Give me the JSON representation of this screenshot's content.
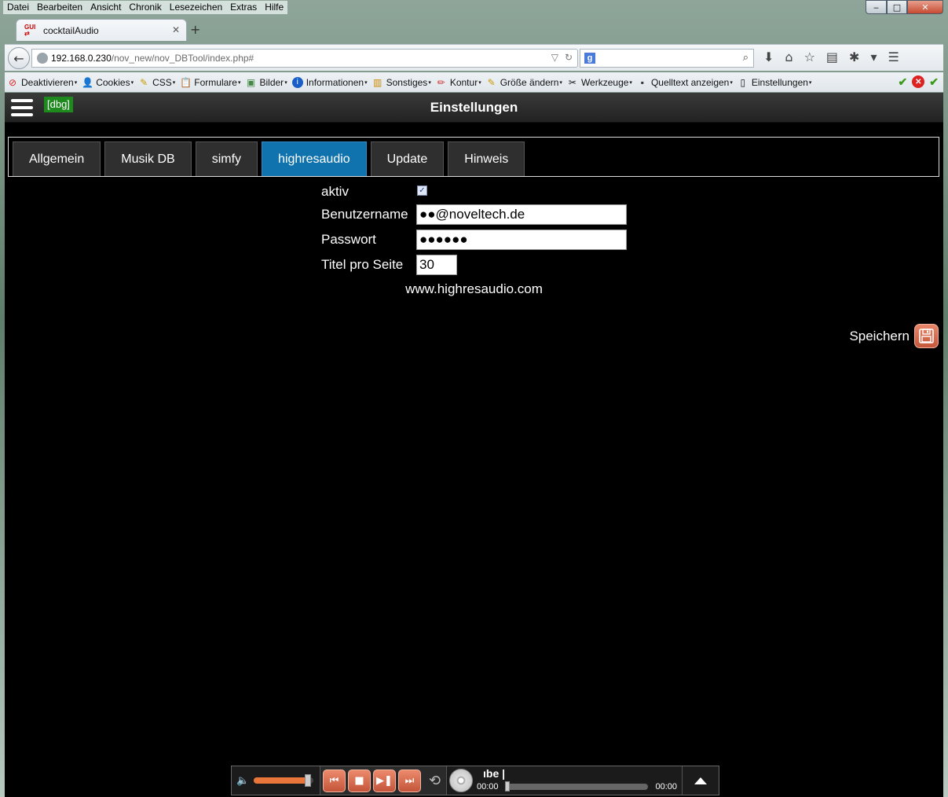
{
  "menu": {
    "items": [
      "Datei",
      "Bearbeiten",
      "Ansicht",
      "Chronik",
      "Lesezeichen",
      "Extras",
      "Hilfe"
    ]
  },
  "window_controls": {
    "minimize": "‒",
    "maximize": "□",
    "close": "✕"
  },
  "browser_tab": {
    "title": "cocktailAudio",
    "close": "✕",
    "new_tab": "+"
  },
  "address_bar": {
    "host": "192.168.0.230",
    "path": "/nov_new/nov_DBTool/index.php#"
  },
  "search_bar": {
    "engine": "g",
    "value": ""
  },
  "dev_toolbar": {
    "items": [
      "Deaktivieren",
      "Cookies",
      "CSS",
      "Formulare",
      "Bilder",
      "Informationen",
      "Sonstiges",
      "Kontur",
      "Größe ändern",
      "Werkzeuge",
      "Quelltext anzeigen",
      "Einstellungen"
    ]
  },
  "app": {
    "debug_badge": "[dbg]",
    "title": "Einstellungen",
    "tabs": [
      {
        "label": "Allgemein",
        "active": false
      },
      {
        "label": "Musik DB",
        "active": false
      },
      {
        "label": "simfy",
        "active": false
      },
      {
        "label": "highresaudio",
        "active": true
      },
      {
        "label": "Update",
        "active": false
      },
      {
        "label": "Hinweis",
        "active": false
      }
    ],
    "form": {
      "aktiv_label": "aktiv",
      "aktiv_checked": true,
      "username_label": "Benutzername",
      "username_value": "●●@noveltech.de",
      "password_label": "Passwort",
      "password_value": "●●●●●●",
      "titles_label": "Titel pro Seite",
      "titles_value": "30"
    },
    "site_link": "www.highresaudio.com",
    "save_label": "Speichern"
  },
  "player": {
    "volume_level": 0.9,
    "track_title": "ıbe |",
    "elapsed": "00:00",
    "total": "00:00",
    "progress": 0.0
  },
  "colors": {
    "active_tab": "#1173ad",
    "accent_orange": "#e8753a",
    "debug_green": "#1e8a1e"
  }
}
